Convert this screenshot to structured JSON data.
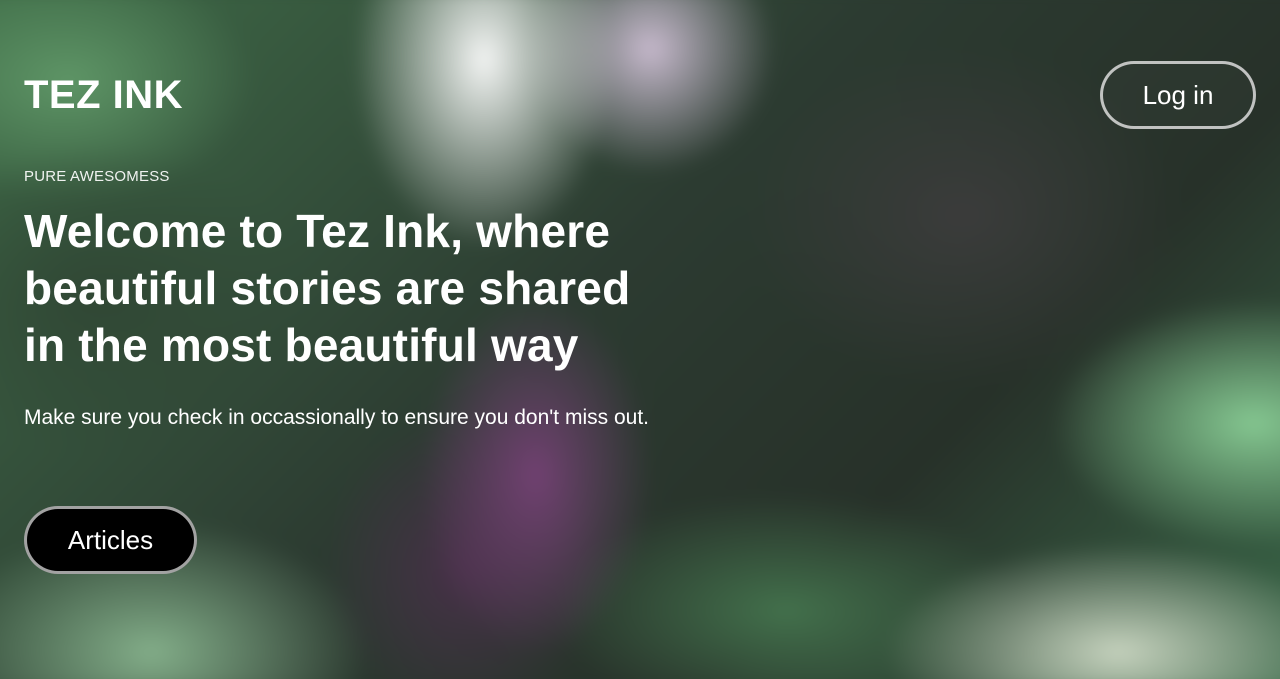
{
  "header": {
    "brand": "TEZ INK",
    "login_label": "Log in"
  },
  "hero": {
    "eyebrow": "PURE AWESOMESS",
    "headline": "Welcome to Tez Ink, where beautiful stories are shared in the most beautiful way",
    "subtext": "Make sure you check in occassionally to ensure you don't miss out.",
    "cta_label": "Articles"
  },
  "colors": {
    "text": "#ffffff",
    "cta_background": "#000000",
    "button_border": "#dcdcdc"
  }
}
